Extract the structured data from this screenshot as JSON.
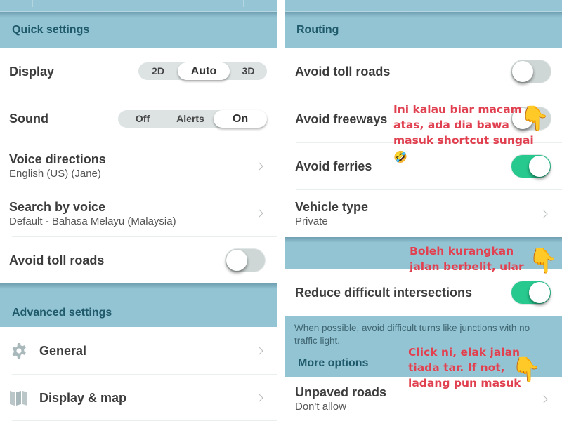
{
  "left": {
    "quick_settings": {
      "header": "Quick settings",
      "display": {
        "label": "Display",
        "options": [
          "2D",
          "Auto",
          "3D"
        ],
        "selected": "Auto"
      },
      "sound": {
        "label": "Sound",
        "options": [
          "Off",
          "Alerts",
          "On"
        ],
        "selected": "On"
      },
      "voice_directions": {
        "label": "Voice directions",
        "value": "English (US) (Jane)"
      },
      "search_by_voice": {
        "label": "Search by voice",
        "value": "Default - Bahasa Melayu (Malaysia)"
      },
      "avoid_toll_roads": {
        "label": "Avoid toll roads",
        "enabled": false
      }
    },
    "advanced_settings": {
      "header": "Advanced settings",
      "items": [
        {
          "label": "General",
          "icon": "gear-icon"
        },
        {
          "label": "Display & map",
          "icon": "map-icon"
        }
      ]
    }
  },
  "right": {
    "routing": {
      "header": "Routing",
      "avoid_toll_roads": {
        "label": "Avoid toll roads",
        "enabled": false
      },
      "avoid_freeways": {
        "label": "Avoid freeways",
        "enabled": false
      },
      "avoid_ferries": {
        "label": "Avoid ferries",
        "enabled": true
      },
      "vehicle_type": {
        "label": "Vehicle type",
        "value": "Private"
      },
      "reduce_difficult_intersections": {
        "label": "Reduce difficult intersections",
        "enabled": true,
        "description": "When possible, avoid difficult turns like junctions with no traffic light."
      }
    },
    "more_options": {
      "header": "More options",
      "unpaved_roads": {
        "label": "Unpaved roads",
        "value": "Don't allow"
      }
    }
  },
  "annotations": {
    "note1": "Ini kalau biar macam atas, ada dia bawa masuk shortcut sungai",
    "note1_emoji": "🤣",
    "note2": "Boleh kurangkan jalan berbelit, ular",
    "note3": "Click ni, elak jalan tiada tar. If not, ladang pun masuk",
    "pointer_emoji": "👇"
  },
  "colors": {
    "section_bg": "#93c4d4",
    "section_text": "#1f5a6b",
    "toggle_on": "#27c98f",
    "toggle_off": "#cfd7d6",
    "annotation_text": "#e0404f"
  }
}
